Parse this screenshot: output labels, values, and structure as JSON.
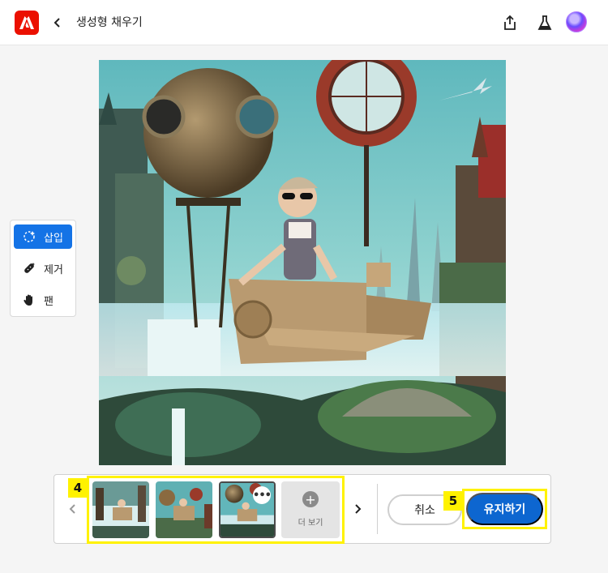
{
  "header": {
    "title": "생성형 채우기",
    "logo_icon": "adobe-logo",
    "back_icon": "chevron-left-icon",
    "actions": [
      "share-icon",
      "labs-flask-icon",
      "user-avatar"
    ]
  },
  "tools": {
    "items": [
      {
        "label": "삽입",
        "icon": "insert-sparkle-icon",
        "active": true
      },
      {
        "label": "제거",
        "icon": "remove-bandage-icon",
        "active": false
      },
      {
        "label": "팬",
        "icon": "pan-hand-icon",
        "active": false
      }
    ]
  },
  "variations": {
    "count_shown": 3,
    "selected_index": 2,
    "more_label": "더 보기",
    "prev_icon": "chevron-left-icon",
    "next_icon": "chevron-right-icon"
  },
  "actions": {
    "cancel_label": "취소",
    "keep_label": "유지하기"
  },
  "annotations": {
    "callout_4": "4",
    "callout_5": "5",
    "highlight_color": "#fff200"
  },
  "colors": {
    "accent": "#1473e6",
    "keep_button": "#0d66d0",
    "adobe_red": "#eb1000"
  }
}
